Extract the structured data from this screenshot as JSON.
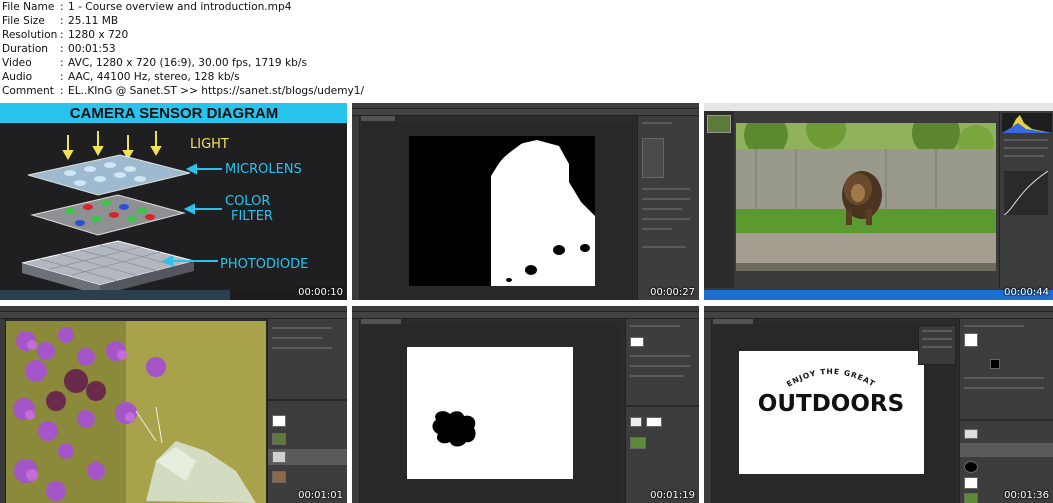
{
  "info": [
    {
      "key": "File Name",
      "sep": ":",
      "value": "1 - Course overview and introduction.mp4"
    },
    {
      "key": "File Size",
      "sep": ":",
      "value": "25.11 MB"
    },
    {
      "key": "Resolution",
      "sep": ":",
      "value": "1280 x 720"
    },
    {
      "key": "Duration",
      "sep": ":",
      "value": "00:01:53"
    },
    {
      "key": "Video",
      "sep": ":",
      "value": "AVC, 1280 x 720 (16:9), 30.00 fps, 1719 kb/s"
    },
    {
      "key": "Audio",
      "sep": ":",
      "value": "AAC, 44100 Hz, stereo, 128 kb/s"
    },
    {
      "key": "Comment",
      "sep": ":",
      "value": "EL..KInG @ Sanet.ST >> https://sanet.st/blogs/udemy1/"
    }
  ],
  "thumbs": {
    "t1": {
      "timestamp": "00:00:10",
      "title": "CAMERA SENSOR DIAGRAM",
      "labels": {
        "light": "LIGHT",
        "microlens": "MICROLENS",
        "color": "COLOR",
        "filter": "FILTER",
        "photodiode": "PHOTODIODE"
      }
    },
    "t2": {
      "timestamp": "00:00:27"
    },
    "t3": {
      "timestamp": "00:00:44"
    },
    "t4": {
      "timestamp": "00:01:01"
    },
    "t5": {
      "timestamp": "00:01:19"
    },
    "t6": {
      "timestamp": "00:01:36",
      "arc_text": "ENJOY THE GREAT",
      "headline": "OUTDOORS"
    }
  },
  "colors": {
    "sensor_banner": "#29c4ee",
    "ps_dark": "#282828",
    "ps_panel": "#3d3d3d",
    "ps_blue_bar": "#1c6fd1"
  }
}
